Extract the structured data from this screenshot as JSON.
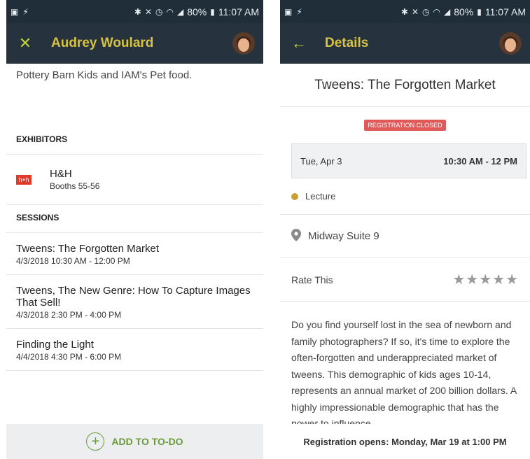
{
  "status_bar": {
    "battery": "80%",
    "time": "11:07 AM"
  },
  "left_screen": {
    "toolbar": {
      "nav_icon": "close-icon",
      "title": "Audrey Woulard"
    },
    "intro_text": "Pottery Barn Kids and IAM's Pet food.",
    "exhibitors": {
      "heading": "EXHIBITORS",
      "items": [
        {
          "logo": "h+h",
          "name": "H&H",
          "booth": "Booths 55-56"
        }
      ]
    },
    "sessions": {
      "heading": "SESSIONS",
      "items": [
        {
          "title": "Tweens: The Forgotten Market",
          "time": "4/3/2018 10:30 AM - 12:00 PM"
        },
        {
          "title": "Tweens, The New Genre: How To Capture Images That Sell!",
          "time": "4/3/2018 2:30 PM - 4:00 PM"
        },
        {
          "title": "Finding the Light",
          "time": "4/4/2018 4:30 PM - 6:00 PM"
        }
      ]
    },
    "todo_button": {
      "icon": "plus-circle-icon",
      "label": "ADD TO TO-DO"
    }
  },
  "right_screen": {
    "toolbar": {
      "nav_icon": "back-arrow-icon",
      "title": "Details"
    },
    "event_title": "Tweens: The Forgotten Market",
    "registration_badge": "REGISTRATION CLOSED",
    "date": "Tue, Apr 3",
    "time": "10:30 AM - 12 PM",
    "type": {
      "label": "Lecture",
      "color": "#c8a032"
    },
    "location": {
      "icon": "map-pin-icon",
      "label": "Midway Suite 9"
    },
    "rating": {
      "label": "Rate This",
      "stars": "★★★★★"
    },
    "description": "Do you find yourself lost in the sea of newborn and family photographers? If so, it's time to explore the often-forgotten and underappreciated market of tweens. This demographic of kids ages 10-14, represents an annual market of 200 billion dollars. A highly impressionable demographic that has the power to influence",
    "footer": "Registration opens: Monday, Mar 19 at 1:00 PM"
  },
  "colors": {
    "header_bg": "#26333f",
    "title_gold": "#d7c242",
    "accent_green": "#6a9a3c",
    "badge_red": "#e05a5a"
  }
}
